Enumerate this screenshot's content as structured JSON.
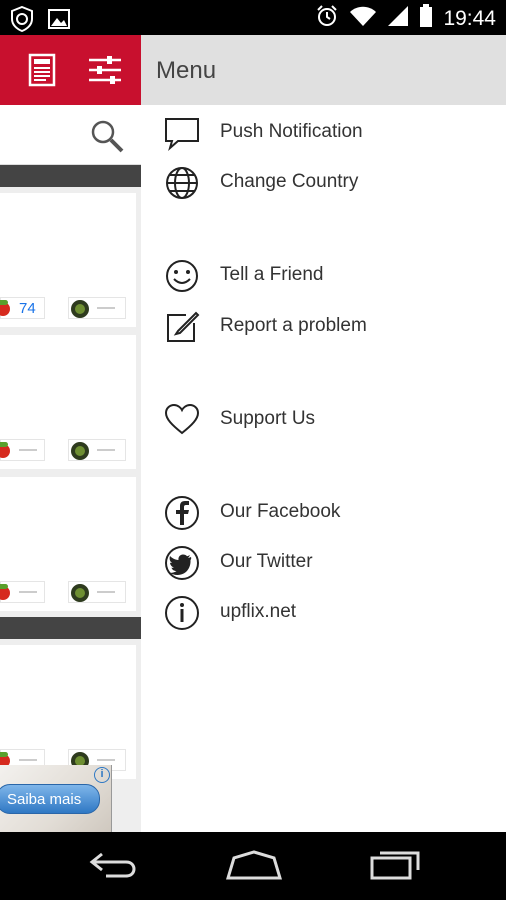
{
  "status_bar": {
    "time": "19:44",
    "icons": [
      "shield-icon",
      "image-icon",
      "alarm-icon",
      "wifi-icon",
      "signal-icon",
      "battery-icon"
    ]
  },
  "colors": {
    "toolbar_red": "#c8102e",
    "drawer_header": "#e0e0e0",
    "link_blue": "#1a73e8"
  },
  "background_app": {
    "toolbar_icons": [
      "news-icon",
      "sliders-icon"
    ],
    "search_icon": "search-icon",
    "cards": [
      {
        "tomato_score": "74"
      },
      {
        "tomato_score": ""
      },
      {
        "tomato_score": ""
      },
      {
        "tomato_score": ""
      }
    ],
    "ad": {
      "button_label": "Saiba mais",
      "info_icon": "i"
    }
  },
  "drawer": {
    "title": "Menu",
    "items": [
      {
        "label": "Push Notification",
        "icon": "speech-bubble-icon"
      },
      {
        "label": "Change Country",
        "icon": "globe-icon"
      },
      {
        "label": "Tell a Friend",
        "icon": "smiley-icon"
      },
      {
        "label": "Report a problem",
        "icon": "edit-icon"
      },
      {
        "label": "Support Us",
        "icon": "heart-icon"
      },
      {
        "label": "Our Facebook",
        "icon": "facebook-icon"
      },
      {
        "label": "Our Twitter",
        "icon": "twitter-icon"
      },
      {
        "label": "upflix.net",
        "icon": "info-icon"
      }
    ]
  },
  "nav_bar": {
    "buttons": [
      "back-icon",
      "home-icon",
      "recents-icon"
    ]
  }
}
